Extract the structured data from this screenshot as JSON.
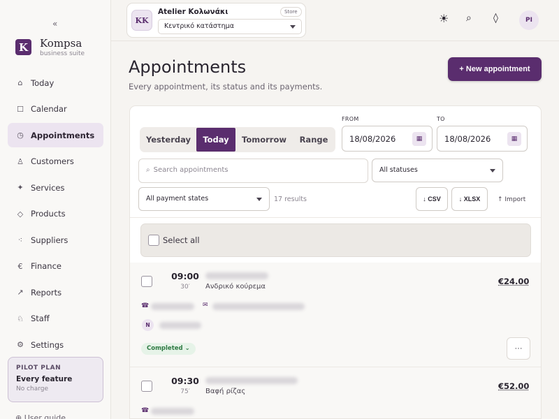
{
  "sidebar": {
    "collapse_glyph": "«",
    "brand_initial": "K",
    "brand": "Kompsa",
    "brand_sub": "business suite",
    "items": [
      {
        "label": "Today",
        "icon": "⌂"
      },
      {
        "label": "Calendar",
        "icon": "☐"
      },
      {
        "label": "Appointments",
        "icon": "◷"
      },
      {
        "label": "Customers",
        "icon": "♙"
      },
      {
        "label": "Services",
        "icon": "✦"
      },
      {
        "label": "Products",
        "icon": "◇"
      },
      {
        "label": "Suppliers",
        "icon": "⁖"
      },
      {
        "label": "Finance",
        "icon": "€"
      },
      {
        "label": "Reports",
        "icon": "↗"
      },
      {
        "label": "Staff",
        "icon": "♘"
      },
      {
        "label": "Settings",
        "icon": "⚙"
      }
    ],
    "active_index": 2,
    "plan": {
      "title": "PILOT PLAN",
      "feature": "Every feature",
      "note": "No charge"
    },
    "guide": "User guide"
  },
  "topbar": {
    "store_initials": "KK",
    "store_name": "Atelier Κολωνάκι",
    "store_badge": "Store",
    "branch": "Κεντρικό κατάστημα",
    "icons": {
      "theme": "☀",
      "search": "⌕",
      "notify": "◊"
    },
    "user_initials": "PI"
  },
  "header": {
    "title": "Appointments",
    "subtitle": "Every appointment, its status and its payments.",
    "new_button": "+ New appointment"
  },
  "filters": {
    "range_tabs": [
      "Yesterday",
      "Today",
      "Tomorrow",
      "Range"
    ],
    "active_tab": 1,
    "from_label": "FROM",
    "to_label": "TO",
    "from_value": "18/08/2026",
    "to_value": "18/08/2026",
    "search_placeholder": "Search appointments",
    "status_select": "All statuses",
    "payment_select": "All payment states",
    "results": "17 results",
    "csv": "↓ CSV",
    "xlsx": "↓ XLSX",
    "import": "↑ Import"
  },
  "list": {
    "select_all": "Select all",
    "appointments": [
      {
        "time": "09:00",
        "duration": "30′",
        "service": "Ανδρικό κούρεμα",
        "price": "€24.00",
        "status": "Completed ⌄",
        "more": "···",
        "note_badge": "N"
      },
      {
        "time": "09:30",
        "duration": "75′",
        "service": "Βαφή ρίζας",
        "price": "€52.00"
      }
    ]
  },
  "colors": {
    "accent": "#5a2d6e",
    "status_completed": "#2f7a43"
  }
}
